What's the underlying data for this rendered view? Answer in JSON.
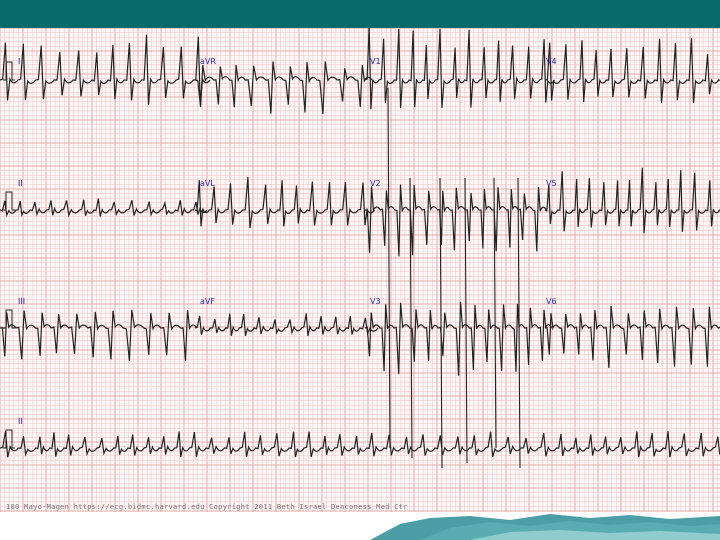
{
  "ecg": {
    "leads": {
      "row1": [
        "I",
        "aVR",
        "V1",
        "V4"
      ],
      "row2": [
        "II",
        "aVL",
        "V2",
        "V5"
      ],
      "row3": [
        "III",
        "aVF",
        "V3",
        "V6"
      ],
      "rhythm": "II"
    },
    "footer": "100 Mayo-Magen    https://ecg.bidmc.harvard.edu    Copyright 2011 Beth Israel Deaconess Med Ctr"
  },
  "colors": {
    "top_bar": "#0b6a6c",
    "grid_minor": "#f0c4c4",
    "grid_major": "#d79a9a",
    "trace": "#222222",
    "label": "#2a2a9a",
    "bottom_accent": "#2b8d95"
  }
}
